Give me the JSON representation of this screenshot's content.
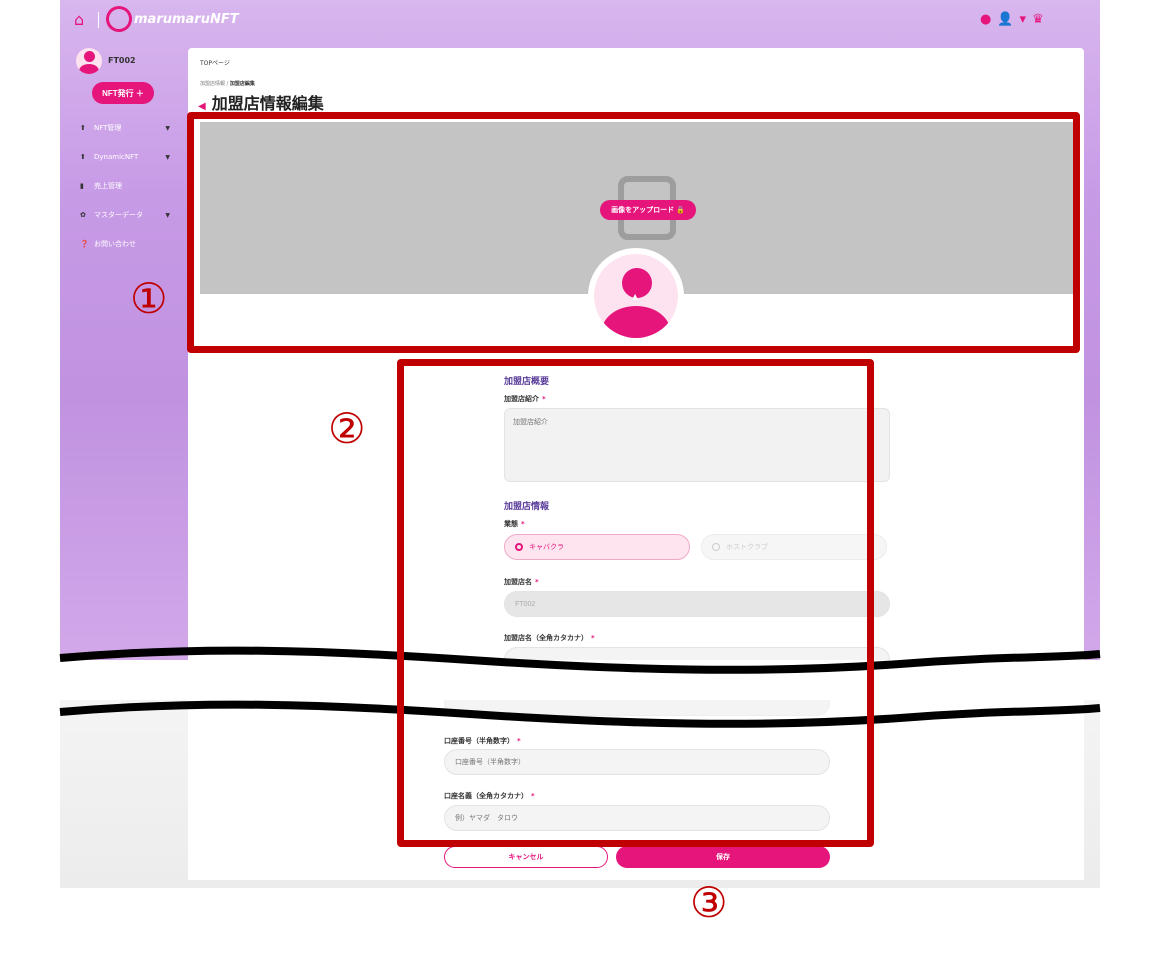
{
  "header": {
    "home_icon": "home-icon",
    "logo_text": "marumaruNFT",
    "icons": [
      "bell-icon",
      "user-icon",
      "chevron-down-icon",
      "cart-icon"
    ]
  },
  "sidebar": {
    "user_name": "FT002",
    "nft_issue_label": "NFT発行 ＋",
    "items": [
      {
        "label": "NFT管理",
        "has_chevron": true
      },
      {
        "label": "DynamicNFT",
        "has_chevron": true
      },
      {
        "label": "売上管理",
        "has_chevron": false
      },
      {
        "label": "マスターデータ",
        "has_chevron": true
      },
      {
        "label": "お問い合わせ",
        "has_chevron": false
      }
    ]
  },
  "main": {
    "top_link": "TOPページ",
    "breadcrumb": [
      "加盟店情報",
      "加盟店編集"
    ],
    "title": "加盟店情報編集",
    "upload_label": "画像をアップロード 🔒"
  },
  "form": {
    "overview_heading": "加盟店概要",
    "intro_label": "加盟店紹介",
    "intro_placeholder": "加盟店紹介",
    "info_heading": "加盟店情報",
    "type_label": "業態",
    "type_options": [
      {
        "label": "キャバクラ",
        "selected": true
      },
      {
        "label": "ホストクラブ",
        "selected": false
      }
    ],
    "name_label": "加盟店名",
    "name_value": "FT002",
    "kana_label": "加盟店名（全角カタカナ）",
    "account_number_label": "口座番号（半角数字）",
    "account_number_placeholder": "口座番号（半角数字）",
    "account_holder_label": "口座名義（全角カタカナ）",
    "account_holder_placeholder": "例）ヤマダ　タロウ",
    "required_mark": "*",
    "cancel_label": "キャンセル",
    "save_label": "保存"
  },
  "callouts": [
    "①",
    "②",
    "③"
  ]
}
